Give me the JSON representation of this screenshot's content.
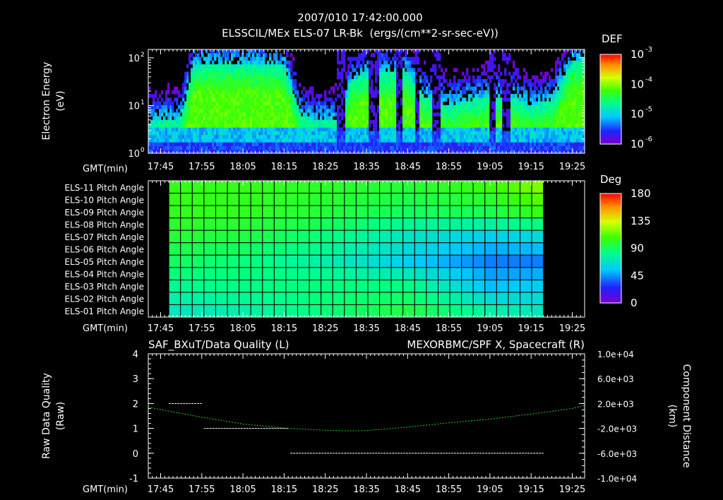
{
  "header": {
    "title": "2007/010 17:42:00.000",
    "subtitle": "ELSSCIL/MEx ELS-07 LR-Bk  (ergs/(cm**2-sr-sec-eV))"
  },
  "colors": {
    "background": "#000000",
    "foreground": "#ffffff",
    "right_series": "#22cc22",
    "grid": "#000000",
    "colorbar_stops": [
      "#7a00d0",
      "#2020ff",
      "#00c8ff",
      "#00ff88",
      "#40ff00",
      "#d8ff00",
      "#ff9000",
      "#ff0000"
    ]
  },
  "time_axis": {
    "label": "GMT(min)",
    "ticks": [
      "17:45",
      "17:55",
      "18:05",
      "18:15",
      "18:25",
      "18:35",
      "18:45",
      "18:55",
      "19:05",
      "19:15",
      "19:25"
    ]
  },
  "chart_data": [
    {
      "type": "heatmap",
      "name": "spectrogram",
      "ylabel": [
        "Electron Energy",
        "(eV)"
      ],
      "xlabel": "GMT(min)",
      "y_scale": "log",
      "ylim": [
        1,
        150
      ],
      "y_ticks": [
        {
          "value": 1,
          "label": "10",
          "exp": "0"
        },
        {
          "value": 10,
          "label": "10",
          "exp": "1"
        },
        {
          "value": 100,
          "label": "10",
          "exp": "2"
        }
      ],
      "x_range_min": [
        -3,
        103
      ],
      "x_ticks_min": [
        0,
        10,
        20,
        30,
        40,
        50,
        60,
        70,
        80,
        90,
        100
      ],
      "colorbar": {
        "title": "DEF",
        "scale": "log",
        "range": [
          1e-06,
          0.001
        ],
        "ticks": [
          {
            "value": 0.001,
            "label": "10",
            "exp": "-3"
          },
          {
            "value": 0.0001,
            "label": "10",
            "exp": "-4"
          },
          {
            "value": 1e-05,
            "label": "10",
            "exp": "-5"
          },
          {
            "value": 1e-06,
            "label": "10",
            "exp": "-6"
          }
        ]
      },
      "ridge_top_log_eV": [
        [
          -3,
          0.65
        ],
        [
          5,
          0.75
        ],
        [
          8,
          1.85
        ],
        [
          12,
          1.9
        ],
        [
          20,
          1.9
        ],
        [
          30,
          1.85
        ],
        [
          34,
          0.8
        ],
        [
          38,
          0.7
        ],
        [
          44,
          0.75
        ],
        [
          46,
          1.5
        ],
        [
          50,
          1.7
        ],
        [
          60,
          1.7
        ],
        [
          64,
          1.2
        ],
        [
          70,
          1.0
        ],
        [
          74,
          1.1
        ],
        [
          80,
          1.2
        ],
        [
          85,
          1.2
        ],
        [
          90,
          1.0
        ],
        [
          95,
          1.1
        ],
        [
          100,
          1.9
        ],
        [
          103,
          2.0
        ]
      ],
      "gaps_min": [
        [
          43,
          45
        ],
        [
          50.5,
          53
        ],
        [
          57,
          58.5
        ],
        [
          62,
          63
        ],
        [
          66,
          68
        ],
        [
          80,
          81.5
        ],
        [
          83,
          85
        ]
      ]
    },
    {
      "type": "heatmap",
      "name": "pitch-angle",
      "xlabel": "GMT(min)",
      "rows": [
        "ELS-11 Pitch Angle",
        "ELS-10 Pitch Angle",
        "ELS-09 Pitch Angle",
        "ELS-08 Pitch Angle",
        "ELS-07 Pitch Angle",
        "ELS-06 Pitch Angle",
        "ELS-05 Pitch Angle",
        "ELS-04 Pitch Angle",
        "ELS-03 Pitch Angle",
        "ELS-02 Pitch Angle",
        "ELS-01 Pitch Angle"
      ],
      "x_range_min": [
        -3,
        103
      ],
      "x_ticks_min": [
        0,
        10,
        20,
        30,
        40,
        50,
        60,
        70,
        80,
        90,
        100
      ],
      "data_extent_min": [
        2,
        93
      ],
      "cells_per_row": 32,
      "colorbar": {
        "title": "Deg",
        "range": [
          0,
          180
        ],
        "ticks": [
          180,
          135,
          90,
          45,
          0
        ]
      },
      "values_deg_sampled": {
        "time_min": [
          2,
          20,
          40,
          60,
          80,
          93
        ],
        "ELS-11": [
          98,
          98,
          95,
          92,
          100,
          115
        ],
        "ELS-09": [
          98,
          97,
          92,
          85,
          88,
          100
        ],
        "ELS-07": [
          92,
          90,
          80,
          65,
          55,
          60
        ],
        "ELS-05": [
          85,
          80,
          70,
          55,
          40,
          40
        ],
        "ELS-03": [
          75,
          78,
          80,
          78,
          50,
          55
        ],
        "ELS-01": [
          65,
          70,
          80,
          90,
          70,
          65
        ]
      }
    },
    {
      "type": "line",
      "name": "quality-and-distance",
      "title_left": "SAF_BXuT/Data Quality (L)",
      "title_right": "MEXORBMC/SPF X, Spacecraft (R)",
      "ylabel_left": [
        "Raw Data Quality",
        "(Raw)"
      ],
      "ylabel_right": [
        "Component Distance",
        "(km)"
      ],
      "xlabel": "GMT(min)",
      "x_range_min": [
        -3,
        103
      ],
      "x_ticks_min": [
        0,
        10,
        20,
        30,
        40,
        50,
        60,
        70,
        80,
        90,
        100
      ],
      "ylim_left": [
        -1,
        4
      ],
      "yticks_left": [
        "-1",
        "0",
        "1",
        "2",
        "3",
        "4"
      ],
      "ylim_right": [
        -10000,
        10000
      ],
      "yticks_right": [
        {
          "value": 10000,
          "label": "1.0e+04"
        },
        {
          "value": 6000,
          "label": "6.0e+03"
        },
        {
          "value": 2000,
          "label": "2.0e+03"
        },
        {
          "value": -2000,
          "label": "-2.0e+03"
        },
        {
          "value": -6000,
          "label": "-6.0e+03"
        },
        {
          "value": -10000,
          "label": "-1.0e+04"
        }
      ],
      "series": [
        {
          "axis": "left",
          "style": "segments",
          "segments": [
            {
              "x": [
                2,
                10
              ],
              "y": 2
            },
            {
              "x": [
                10.5,
                31
              ],
              "y": 1
            },
            {
              "x": [
                31.5,
                93
              ],
              "y": 0
            }
          ]
        },
        {
          "axis": "right",
          "style": "dotted",
          "x": [
            -3,
            10,
            20,
            30,
            40,
            45,
            50,
            60,
            70,
            80,
            90,
            100,
            103
          ],
          "y": [
            1400,
            -200,
            -1300,
            -1950,
            -2300,
            -2400,
            -2350,
            -1800,
            -1100,
            -500,
            300,
            1200,
            1700
          ]
        }
      ]
    }
  ]
}
